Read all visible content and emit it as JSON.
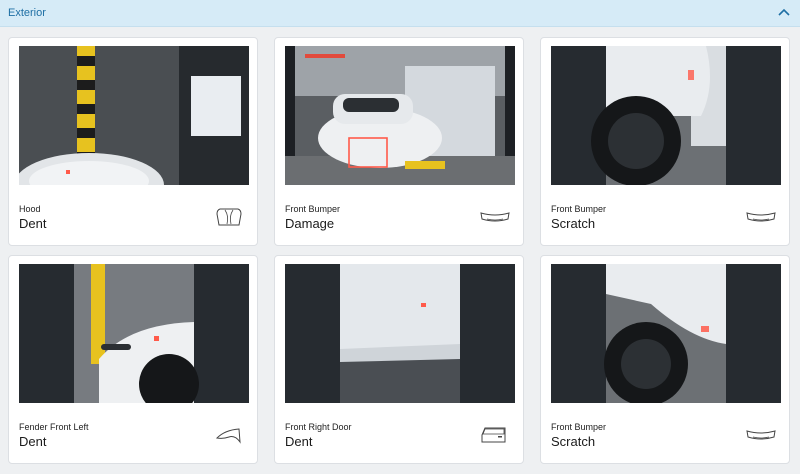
{
  "section": {
    "title": "Exterior",
    "collapse_icon": "chevron-up-icon",
    "accent_color": "#1f6fa4",
    "header_background": "#d6ebf7"
  },
  "cards": [
    {
      "part": "Hood",
      "damage": "Dent",
      "part_icon": "hood-icon"
    },
    {
      "part": "Front Bumper",
      "damage": "Damage",
      "part_icon": "front-bumper-icon"
    },
    {
      "part": "Front Bumper",
      "damage": "Scratch",
      "part_icon": "front-bumper-icon"
    },
    {
      "part": "Fender Front Left",
      "damage": "Dent",
      "part_icon": "fender-icon"
    },
    {
      "part": "Front Right Door",
      "damage": "Dent",
      "part_icon": "door-icon"
    },
    {
      "part": "Front Bumper",
      "damage": "Scratch",
      "part_icon": "front-bumper-icon"
    }
  ],
  "damage_marker_color": "#ff5a4a"
}
